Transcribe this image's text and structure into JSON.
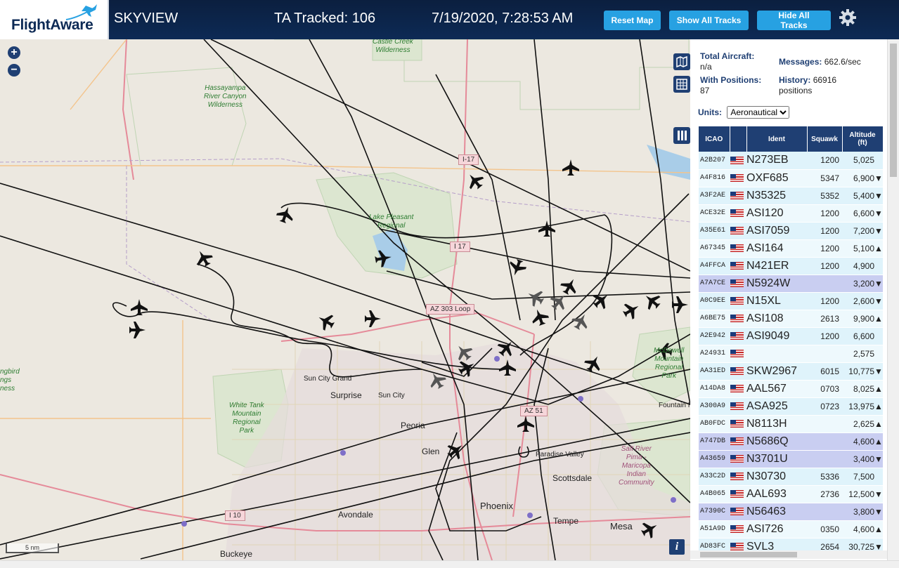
{
  "header": {
    "logo_text": "FlightAware",
    "app_title": "SKYVIEW",
    "ta_tracked": "TA Tracked: 106",
    "clock": "7/19/2020, 7:28:53 AM",
    "buttons": {
      "reset": "Reset Map",
      "show_all": "Show All Tracks",
      "hide_all": "Hide All Tracks"
    },
    "settings_icon": "gear-icon"
  },
  "map": {
    "zoom_in": "+",
    "zoom_out": "−",
    "scale": "5 nm",
    "info": "i",
    "labels": {
      "castle_creek": "Castle Creek\nWilderness",
      "hassayampa": "Hassayampa\nRiver Canyon\nWilderness",
      "lake_pleasant": "Lake Pleasant\nRegional",
      "white_tank": "White Tank\nMountain\nRegional\nPark",
      "mcdowell": "McDowell\nMountain\nRegional\nPark",
      "salt_river": "Salt River\nPima -\nMaricopa\nIndian\nCommunity",
      "hummingbird": "ngbird\nngs\nness",
      "sun_city_grand": "Sun City Grand",
      "surprise": "Surprise",
      "sun_city": "Sun City",
      "peoria": "Peoria",
      "glendale": "Glen",
      "paradise_valley": "Paradise Valley",
      "scottsdale": "Scottsdale",
      "phoenix": "Phoenix",
      "avondale": "Avondale",
      "tempe": "Tempe",
      "mesa": "Mesa",
      "buckeye": "Buckeye",
      "fountain_hills": "Fountain H"
    },
    "shields": {
      "i17a": "I-17",
      "i17b": "I 17",
      "az303": "AZ 303 Loop",
      "az51": "AZ 51",
      "i10": "I 10"
    }
  },
  "panel": {
    "total_aircraft_label": "Total Aircraft:",
    "total_aircraft_value": "n/a",
    "messages_label": "Messages:",
    "messages_value": "662.6/sec",
    "with_positions_label": "With Positions:",
    "with_positions_value": "87",
    "history_label": "History:",
    "history_value": "66916",
    "history_unit": "positions",
    "units_label": "Units:",
    "units_value": "Aeronautical",
    "columns": [
      "ICAO",
      "",
      "Ident",
      "Squawk",
      "Altitude\n(ft)"
    ],
    "rows": [
      {
        "icao": "A2B207",
        "ident": "N273EB",
        "squawk": "1200",
        "alt": "5,025",
        "trend": "",
        "sel": false
      },
      {
        "icao": "A4F816",
        "ident": "OXF685",
        "squawk": "5347",
        "alt": "6,900",
        "trend": "▼",
        "sel": false
      },
      {
        "icao": "A3F2AE",
        "ident": "N35325",
        "squawk": "5352",
        "alt": "5,400",
        "trend": "▼",
        "sel": false
      },
      {
        "icao": "ACE32E",
        "ident": "ASI120",
        "squawk": "1200",
        "alt": "6,600",
        "trend": "▼",
        "sel": false
      },
      {
        "icao": "A35E61",
        "ident": "ASI7059",
        "squawk": "1200",
        "alt": "7,200",
        "trend": "▼",
        "sel": false
      },
      {
        "icao": "A67345",
        "ident": "ASI164",
        "squawk": "1200",
        "alt": "5,100",
        "trend": "▲",
        "sel": false
      },
      {
        "icao": "A4FFCA",
        "ident": "N421ER",
        "squawk": "1200",
        "alt": "4,900",
        "trend": "",
        "sel": false
      },
      {
        "icao": "A7A7CE",
        "ident": "N5924W",
        "squawk": "",
        "alt": "3,200",
        "trend": "▼",
        "sel": true
      },
      {
        "icao": "A0C9EE",
        "ident": "N15XL",
        "squawk": "1200",
        "alt": "2,600",
        "trend": "▼",
        "sel": false
      },
      {
        "icao": "A6BE75",
        "ident": "ASI108",
        "squawk": "2613",
        "alt": "9,900",
        "trend": "▲",
        "sel": false
      },
      {
        "icao": "A2E942",
        "ident": "ASI9049",
        "squawk": "1200",
        "alt": "6,600",
        "trend": "",
        "sel": false
      },
      {
        "icao": "A24931",
        "ident": "",
        "squawk": "",
        "alt": "2,575",
        "trend": "",
        "sel": false
      },
      {
        "icao": "AA31ED",
        "ident": "SKW2967",
        "squawk": "6015",
        "alt": "10,775",
        "trend": "▼",
        "sel": false
      },
      {
        "icao": "A14DA8",
        "ident": "AAL567",
        "squawk": "0703",
        "alt": "8,025",
        "trend": "▲",
        "sel": false
      },
      {
        "icao": "A300A9",
        "ident": "ASA925",
        "squawk": "0723",
        "alt": "13,975",
        "trend": "▲",
        "sel": false
      },
      {
        "icao": "AB0FDC",
        "ident": "N8113H",
        "squawk": "",
        "alt": "2,625",
        "trend": "▲",
        "sel": false
      },
      {
        "icao": "A747DB",
        "ident": "N5686Q",
        "squawk": "",
        "alt": "4,600",
        "trend": "▲",
        "sel": true
      },
      {
        "icao": "A43659",
        "ident": "N3701U",
        "squawk": "",
        "alt": "3,400",
        "trend": "▼",
        "sel": true
      },
      {
        "icao": "A33C2D",
        "ident": "N30730",
        "squawk": "5336",
        "alt": "7,500",
        "trend": "",
        "sel": false
      },
      {
        "icao": "A4B065",
        "ident": "AAL693",
        "squawk": "2736",
        "alt": "12,500",
        "trend": "▼",
        "sel": false
      },
      {
        "icao": "A7390C",
        "ident": "N56463",
        "squawk": "",
        "alt": "3,800",
        "trend": "▼",
        "sel": true
      },
      {
        "icao": "A51A9D",
        "ident": "ASI726",
        "squawk": "0350",
        "alt": "4,600",
        "trend": "▲",
        "sel": false
      },
      {
        "icao": "AD83FC",
        "ident": "SVL3",
        "squawk": "2654",
        "alt": "30,725",
        "trend": "▼",
        "sel": false
      }
    ]
  },
  "colors": {
    "header_bg": "#0d2a55",
    "button_bg": "#27a1e2",
    "table_header": "#1f3f73",
    "row_selected": "#c9cef1"
  }
}
